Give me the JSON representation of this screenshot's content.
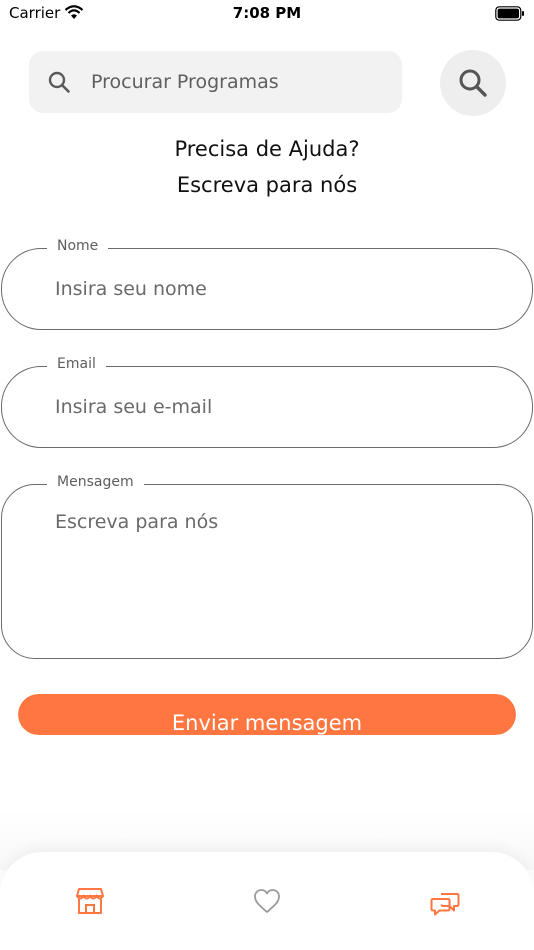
{
  "status_bar": {
    "carrier": "Carrier",
    "time": "7:08 PM"
  },
  "search": {
    "placeholder": "Procurar Programas"
  },
  "heading": {
    "line1": "Precisa de Ajuda?",
    "line2": "Escreva para nós"
  },
  "form": {
    "name": {
      "label": "Nome",
      "placeholder": "Insira seu nome"
    },
    "email": {
      "label": "Email",
      "placeholder": "Insira seu e-mail"
    },
    "message": {
      "label": "Mensagem",
      "placeholder": "Escreva para nós"
    },
    "submit_label": "Enviar mensagem"
  },
  "colors": {
    "accent": "#ff7640",
    "inactive_icon": "#9a9a9a"
  },
  "tab_bar": {
    "tabs": [
      "store-icon",
      "heart-icon",
      "chat-bubbles-icon"
    ],
    "active": "store-icon"
  }
}
